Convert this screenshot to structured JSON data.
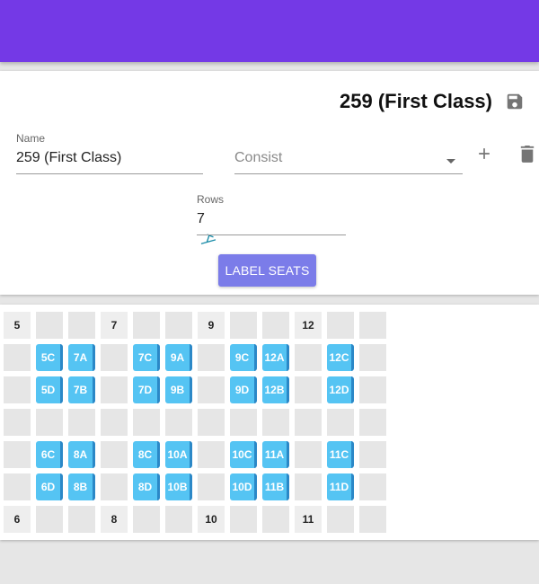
{
  "card": {
    "title": "259 (First Class)",
    "name_label": "Name",
    "name_value": "259 (First Class)",
    "consist_placeholder": "Consist",
    "rows_label": "Rows",
    "rows_value": "7",
    "label_button": "LABEL SEATS"
  },
  "icons": {
    "save": "save-icon",
    "train": "train-icon",
    "add": "add-icon",
    "delete": "delete-icon",
    "dropdown": "chevron-down-icon"
  },
  "colors": {
    "header": "#7439e6",
    "seat": "#55c4f3",
    "button": "#7b7ce9"
  },
  "seat_grid": {
    "rows": [
      [
        {
          "t": "num",
          "v": "5"
        },
        {
          "t": "empty"
        },
        {
          "t": "empty"
        },
        {
          "t": "num",
          "v": "7"
        },
        {
          "t": "empty"
        },
        {
          "t": "empty"
        },
        {
          "t": "num",
          "v": "9"
        },
        {
          "t": "empty"
        },
        {
          "t": "empty"
        },
        {
          "t": "num",
          "v": "12"
        },
        {
          "t": "empty"
        },
        {
          "t": "empty"
        }
      ],
      [
        {
          "t": "empty"
        },
        {
          "t": "seat",
          "v": "5C"
        },
        {
          "t": "seat",
          "v": "7A"
        },
        {
          "t": "empty"
        },
        {
          "t": "seat",
          "v": "7C"
        },
        {
          "t": "seat",
          "v": "9A"
        },
        {
          "t": "empty"
        },
        {
          "t": "seat",
          "v": "9C"
        },
        {
          "t": "seat",
          "v": "12A"
        },
        {
          "t": "empty"
        },
        {
          "t": "seat",
          "v": "12C"
        },
        {
          "t": "empty"
        }
      ],
      [
        {
          "t": "empty"
        },
        {
          "t": "seat",
          "v": "5D"
        },
        {
          "t": "seat",
          "v": "7B"
        },
        {
          "t": "empty"
        },
        {
          "t": "seat",
          "v": "7D"
        },
        {
          "t": "seat",
          "v": "9B"
        },
        {
          "t": "empty"
        },
        {
          "t": "seat",
          "v": "9D"
        },
        {
          "t": "seat",
          "v": "12B"
        },
        {
          "t": "empty"
        },
        {
          "t": "seat",
          "v": "12D"
        },
        {
          "t": "empty"
        }
      ],
      [
        {
          "t": "empty"
        },
        {
          "t": "empty"
        },
        {
          "t": "empty"
        },
        {
          "t": "empty"
        },
        {
          "t": "empty"
        },
        {
          "t": "empty"
        },
        {
          "t": "empty"
        },
        {
          "t": "empty"
        },
        {
          "t": "empty"
        },
        {
          "t": "empty"
        },
        {
          "t": "empty"
        },
        {
          "t": "empty"
        }
      ],
      [
        {
          "t": "empty"
        },
        {
          "t": "seat",
          "v": "6C"
        },
        {
          "t": "seat",
          "v": "8A"
        },
        {
          "t": "empty"
        },
        {
          "t": "seat",
          "v": "8C"
        },
        {
          "t": "seat",
          "v": "10A"
        },
        {
          "t": "empty"
        },
        {
          "t": "seat",
          "v": "10C"
        },
        {
          "t": "seat",
          "v": "11A"
        },
        {
          "t": "empty"
        },
        {
          "t": "seat",
          "v": "11C"
        },
        {
          "t": "empty"
        }
      ],
      [
        {
          "t": "empty"
        },
        {
          "t": "seat",
          "v": "6D"
        },
        {
          "t": "seat",
          "v": "8B"
        },
        {
          "t": "empty"
        },
        {
          "t": "seat",
          "v": "8D"
        },
        {
          "t": "seat",
          "v": "10B"
        },
        {
          "t": "empty"
        },
        {
          "t": "seat",
          "v": "10D"
        },
        {
          "t": "seat",
          "v": "11B"
        },
        {
          "t": "empty"
        },
        {
          "t": "seat",
          "v": "11D"
        },
        {
          "t": "empty"
        }
      ],
      [
        {
          "t": "num",
          "v": "6"
        },
        {
          "t": "empty"
        },
        {
          "t": "empty"
        },
        {
          "t": "num",
          "v": "8"
        },
        {
          "t": "empty"
        },
        {
          "t": "empty"
        },
        {
          "t": "num",
          "v": "10"
        },
        {
          "t": "empty"
        },
        {
          "t": "empty"
        },
        {
          "t": "num",
          "v": "11"
        },
        {
          "t": "empty"
        },
        {
          "t": "empty"
        }
      ]
    ]
  }
}
